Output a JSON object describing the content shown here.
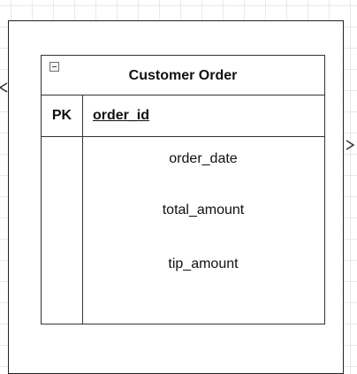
{
  "entity": {
    "title": "Customer Order",
    "primary_key": {
      "key_label": "PK",
      "field": "order_id"
    },
    "attributes": [
      "order_date",
      "total_amount",
      "tip_amount"
    ]
  },
  "colors": {
    "line": "#333333",
    "grid": "#e9e9e9",
    "background": "#ffffff"
  }
}
